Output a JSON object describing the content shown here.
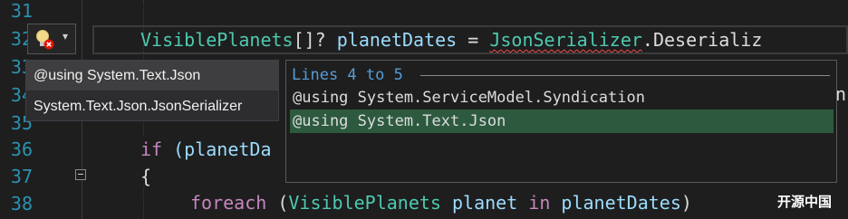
{
  "editor": {
    "line_numbers": [
      "31",
      "32",
      "33",
      "34",
      "35",
      "36",
      "37",
      "38"
    ],
    "line32": {
      "type": "VisiblePlanets",
      "brackets": "[]? ",
      "var": "planetDates",
      "eq": " = ",
      "cls": "JsonSerializer",
      "method": ".Deserializ"
    },
    "line34_tail": "n",
    "line36": {
      "kw": "if",
      "rest": " (planetDa"
    },
    "line37": "{",
    "line38": {
      "kw": "foreach",
      "open": " (",
      "type": "VisiblePlanets",
      "var1": " planet ",
      "kw2": "in",
      "var2": " planetDates",
      "close": ")"
    }
  },
  "lightbulb": {
    "icon": "lightbulb-error-icon",
    "dropdown_icon": "chevron-down-icon"
  },
  "quick_actions_menu": {
    "items": [
      {
        "label": "@using System.Text.Json"
      },
      {
        "label": "System.Text.Json.JsonSerializer"
      }
    ]
  },
  "preview": {
    "header": "Lines 4 to 5",
    "lines": [
      {
        "text": "@using System.ServiceModel.Syndication",
        "added": false
      },
      {
        "text": "@using System.Text.Json",
        "added": true
      }
    ]
  },
  "watermark": "开源中国",
  "colors": {
    "line_number": "#2b91af",
    "type": "#4ec9b0",
    "variable": "#9cdcfe",
    "keyword": "#c586c0",
    "added_highlight": "#2d5a3f",
    "error": "#f14c4c"
  }
}
